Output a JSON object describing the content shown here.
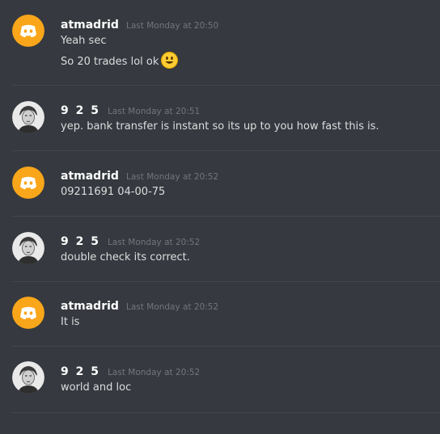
{
  "messages": [
    {
      "author": "atmadrid",
      "avatar_icon": "discord-logo-icon",
      "timestamp": "Last Monday at 20:50",
      "lines": [
        "Yeah sec",
        "So 20 trades lol ok"
      ],
      "emoji": "smiley-emoji-icon"
    },
    {
      "author": "9 2 5",
      "avatar_icon": "user-photo-avatar",
      "timestamp": "Last Monday at 20:51",
      "lines": [
        "yep. bank transfer is instant so its up to you how fast this is."
      ]
    },
    {
      "author": "atmadrid",
      "avatar_icon": "discord-logo-icon",
      "timestamp": "Last Monday at 20:52",
      "lines": [
        "09211691 04-00-75"
      ]
    },
    {
      "author": "9 2 5",
      "avatar_icon": "user-photo-avatar",
      "timestamp": "Last Monday at 20:52",
      "lines": [
        "double check its correct."
      ]
    },
    {
      "author": "atmadrid",
      "avatar_icon": "discord-logo-icon",
      "timestamp": "Last Monday at 20:52",
      "lines": [
        "It is"
      ]
    },
    {
      "author": "9 2 5",
      "avatar_icon": "user-photo-avatar",
      "timestamp": "Last Monday at 20:52",
      "lines": [
        "world and loc"
      ]
    }
  ],
  "colors": {
    "background": "#36393f",
    "discord_avatar": "#faa61a",
    "username": "#ffffff",
    "timestamp": "#72767d",
    "message_text": "#dcddde",
    "divider": "#42454a"
  }
}
